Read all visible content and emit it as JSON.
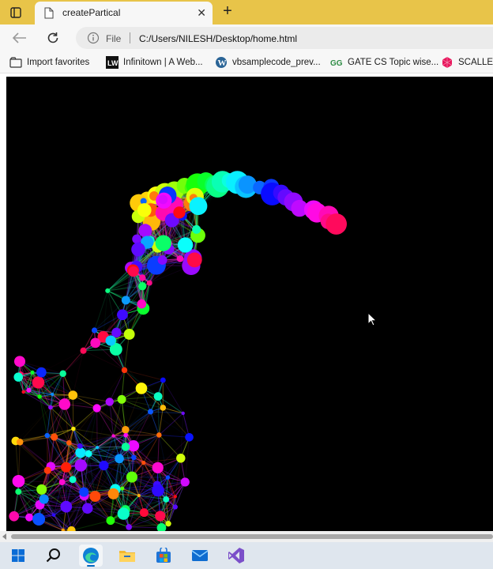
{
  "tab": {
    "title": "createPartical",
    "close_glyph": "✕"
  },
  "new_tab_glyph": "+",
  "toolbar": {
    "file_label": "File",
    "url": "C:/Users/NILESH/Desktop/home.html"
  },
  "favorites": [
    {
      "label": "Import favorites",
      "icon": "import-icon"
    },
    {
      "label": "Infinitown | A Web...",
      "icon": "infinitown-icon"
    },
    {
      "label": "vbsamplecode_prev...",
      "icon": "wordpress-icon"
    },
    {
      "label": "GATE CS Topic wise...",
      "icon": "geeksforgeeks-icon"
    },
    {
      "label": "SCALLEL",
      "icon": "scallel-icon"
    }
  ],
  "taskbar": {
    "items": [
      "windows-start-icon",
      "search-icon",
      "edge-icon",
      "file-explorer-icon",
      "store-icon",
      "mail-icon",
      "visual-studio-icon"
    ]
  },
  "colors": {
    "tabstrip": "#e8c449",
    "canvas": "#000000",
    "taskbar": "#dfe6ee"
  }
}
